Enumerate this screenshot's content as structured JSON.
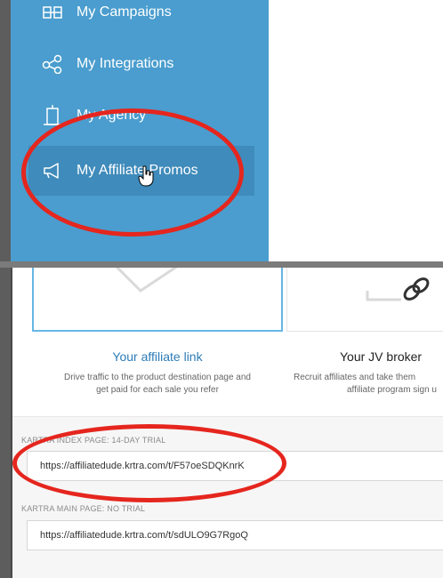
{
  "sidebar": {
    "items": [
      {
        "label": "My Campaigns",
        "icon": "campaigns-icon"
      },
      {
        "label": "My Integrations",
        "icon": "integrations-icon"
      },
      {
        "label": "My Agency",
        "icon": "agency-icon"
      },
      {
        "label": "My Affiliate Promos",
        "icon": "megaphone-icon",
        "active": true
      }
    ]
  },
  "cards": [
    {
      "title": "Your affiliate link",
      "desc_line1": "Drive traffic to the product destination page and",
      "desc_line2": "get paid for each sale you refer",
      "color": "#2d7cb7"
    },
    {
      "title": "Your JV broker",
      "desc_line1": "Recruit affiliates and take them",
      "desc_line2": "affiliate program sign u",
      "color": "#222222"
    }
  ],
  "links": [
    {
      "label": "KARTRA INDEX PAGE: 14-DAY TRIAL",
      "url": "https://affiliatedude.krtra.com/t/F57oeSDQKnrK"
    },
    {
      "label": "KARTRA MAIN PAGE: NO TRIAL",
      "url": "https://affiliatedude.krtra.com/t/sdULO9G7RgoQ"
    }
  ],
  "colors": {
    "sidebar": "#4a9dce",
    "accent_border": "#66b7e4",
    "annotation": "#e5261e"
  }
}
